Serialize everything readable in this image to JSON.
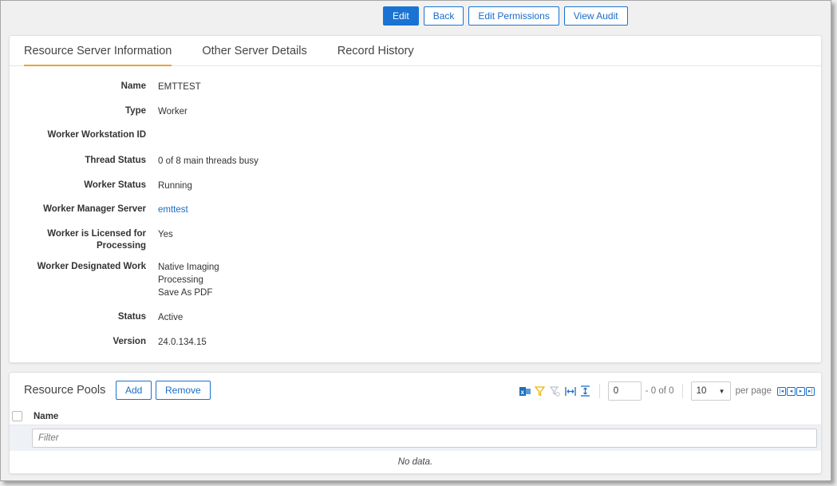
{
  "toolbar": {
    "edit_label": "Edit",
    "back_label": "Back",
    "edit_permissions_label": "Edit Permissions",
    "view_audit_label": "View Audit"
  },
  "tabs": [
    {
      "label": "Resource Server Information",
      "active": true
    },
    {
      "label": "Other Server Details",
      "active": false
    },
    {
      "label": "Record History",
      "active": false
    }
  ],
  "fields": {
    "name": {
      "label": "Name",
      "value": "EMTTEST"
    },
    "type": {
      "label": "Type",
      "value": "Worker"
    },
    "workstation": {
      "label": "Worker Workstation ID",
      "value": ""
    },
    "thread_status": {
      "label": "Thread Status",
      "value": "0 of 8 main threads busy"
    },
    "worker_status": {
      "label": "Worker Status",
      "value": "Running"
    },
    "manager_server": {
      "label": "Worker Manager Server",
      "value": "emttest"
    },
    "licensed": {
      "label_line1": "Worker is Licensed for",
      "label_line2": "Processing",
      "value": "Yes"
    },
    "designated_work": {
      "label": "Worker Designated Work",
      "values": [
        "Native Imaging",
        "Processing",
        "Save As PDF"
      ]
    },
    "status": {
      "label": "Status",
      "value": "Active"
    },
    "version": {
      "label": "Version",
      "value": "24.0.134.15"
    }
  },
  "resource_pools": {
    "title": "Resource Pools",
    "add_label": "Add",
    "remove_label": "Remove",
    "page_value": "0",
    "page_info": "- 0 of 0",
    "per_page_value": "10",
    "per_page_label": "per page",
    "column_name": "Name",
    "filter_placeholder": "Filter",
    "empty_text": "No data."
  },
  "colors": {
    "accent": "#1a73d2",
    "tab_underline": "#e8a435",
    "excel_icon": "#1d6fb8",
    "filter_icon": "#f0b400"
  },
  "icons": [
    "excel-export-icon",
    "filter-icon",
    "clear-filter-icon",
    "fit-columns-icon",
    "row-height-icon",
    "first-page-icon",
    "prev-page-icon",
    "next-page-icon",
    "last-page-icon"
  ]
}
